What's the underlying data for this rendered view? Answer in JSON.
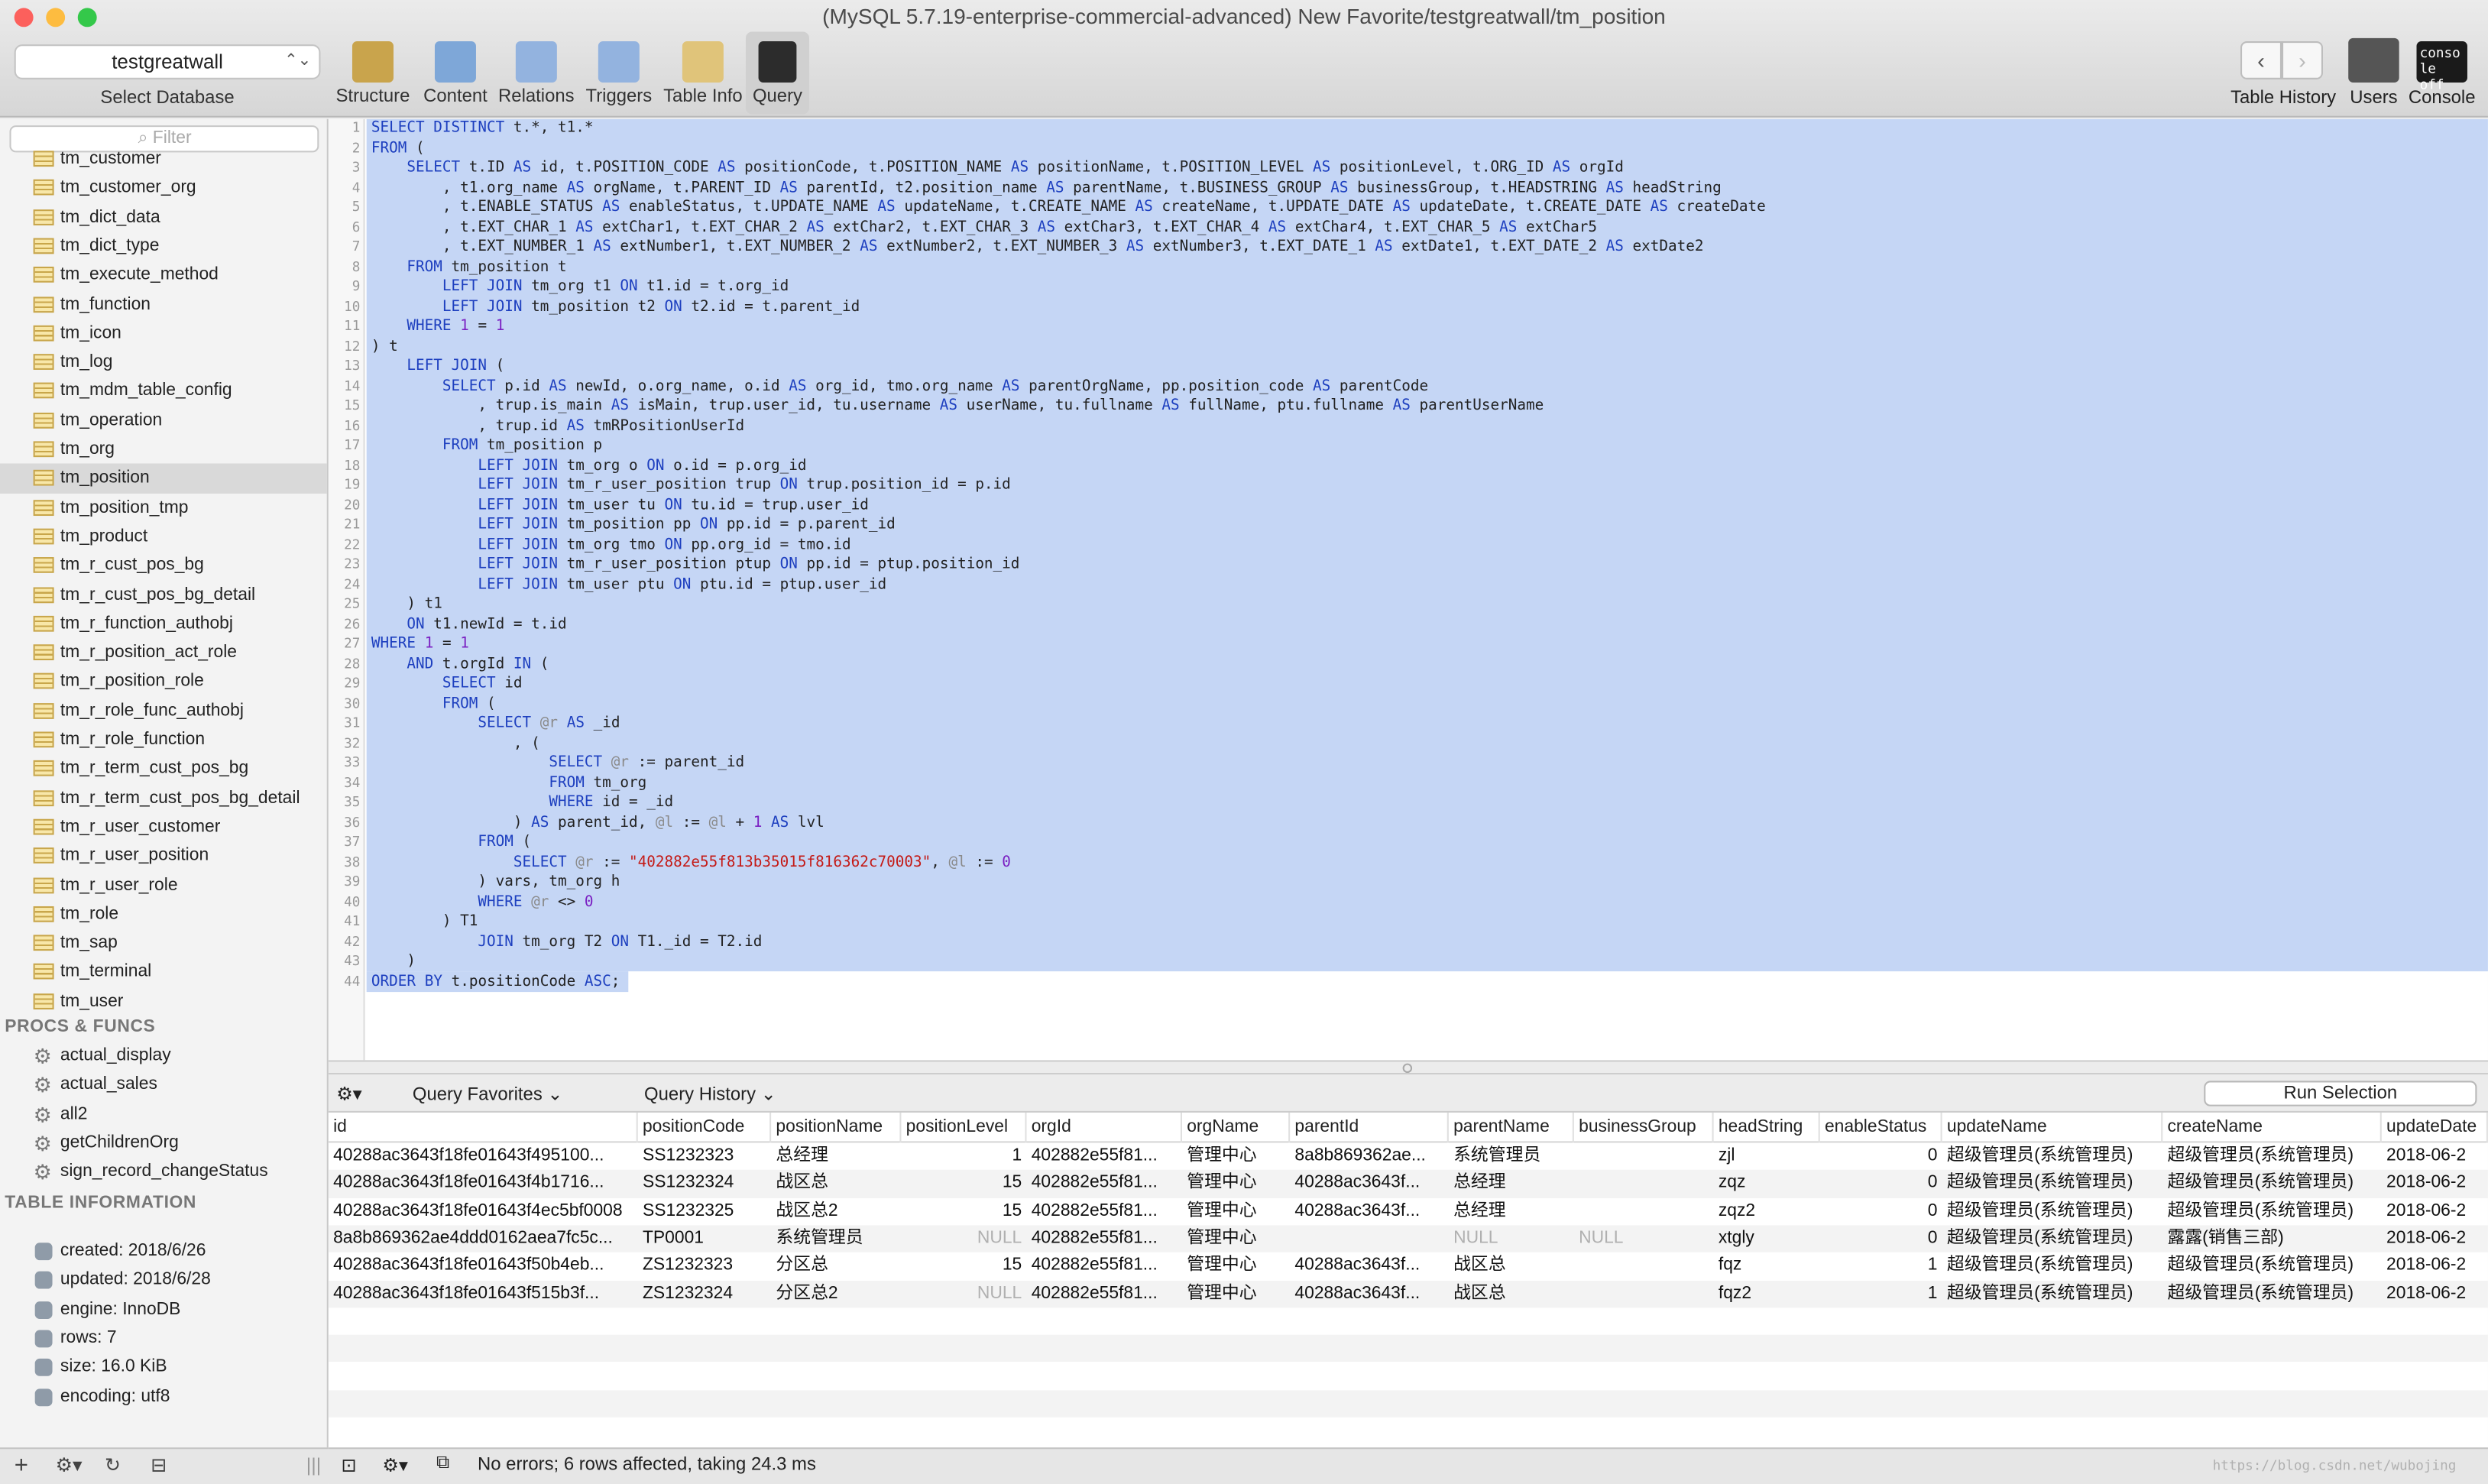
{
  "window": {
    "title": "(MySQL 5.7.19-enterprise-commercial-advanced) New Favorite/testgreatwall/tm_position"
  },
  "database": {
    "selected": "testgreatwall",
    "label": "Select Database"
  },
  "toolbar": [
    "Structure",
    "Content",
    "Relations",
    "Triggers",
    "Table Info",
    "Query"
  ],
  "toolbar_right": [
    "Table History",
    "Users",
    "Console"
  ],
  "sidebar": {
    "filter_placeholder": "Filter",
    "tables": [
      "tm_customer",
      "tm_customer_org",
      "tm_dict_data",
      "tm_dict_type",
      "tm_execute_method",
      "tm_function",
      "tm_icon",
      "tm_log",
      "tm_mdm_table_config",
      "tm_operation",
      "tm_org",
      "tm_position",
      "tm_position_tmp",
      "tm_product",
      "tm_r_cust_pos_bg",
      "tm_r_cust_pos_bg_detail",
      "tm_r_function_authobj",
      "tm_r_position_act_role",
      "tm_r_position_role",
      "tm_r_role_func_authobj",
      "tm_r_role_function",
      "tm_r_term_cust_pos_bg",
      "tm_r_term_cust_pos_bg_detail",
      "tm_r_user_customer",
      "tm_r_user_position",
      "tm_r_user_role",
      "tm_role",
      "tm_sap",
      "tm_terminal",
      "tm_user"
    ],
    "selected_table": "tm_position",
    "procs_header": "PROCS & FUNCS",
    "procs": [
      "actual_display",
      "actual_sales",
      "all2",
      "getChildrenOrg",
      "sign_record_changeStatus"
    ],
    "info_header": "TABLE INFORMATION",
    "info": [
      "created: 2018/6/26",
      "updated: 2018/6/28",
      "engine: InnoDB",
      "rows: 7",
      "size: 16.0 KiB",
      "encoding: utf8"
    ]
  },
  "query_lines": [
    "SELECT DISTINCT t.*, t1.*",
    "FROM (",
    "    SELECT t.ID AS id, t.POSITION_CODE AS positionCode, t.POSITION_NAME AS positionName, t.POSITION_LEVEL AS positionLevel, t.ORG_ID AS orgId",
    "        , t1.org_name AS orgName, t.PARENT_ID AS parentId, t2.position_name AS parentName, t.BUSINESS_GROUP AS businessGroup, t.HEADSTRING AS headString",
    "        , t.ENABLE_STATUS AS enableStatus, t.UPDATE_NAME AS updateName, t.CREATE_NAME AS createName, t.UPDATE_DATE AS updateDate, t.CREATE_DATE AS createDate",
    "        , t.EXT_CHAR_1 AS extChar1, t.EXT_CHAR_2 AS extChar2, t.EXT_CHAR_3 AS extChar3, t.EXT_CHAR_4 AS extChar4, t.EXT_CHAR_5 AS extChar5",
    "        , t.EXT_NUMBER_1 AS extNumber1, t.EXT_NUMBER_2 AS extNumber2, t.EXT_NUMBER_3 AS extNumber3, t.EXT_DATE_1 AS extDate1, t.EXT_DATE_2 AS extDate2",
    "    FROM tm_position t",
    "        LEFT JOIN tm_org t1 ON t1.id = t.org_id",
    "        LEFT JOIN tm_position t2 ON t2.id = t.parent_id",
    "    WHERE 1 = 1",
    ") t",
    "    LEFT JOIN (",
    "        SELECT p.id AS newId, o.org_name, o.id AS org_id, tmo.org_name AS parentOrgName, pp.position_code AS parentCode",
    "            , trup.is_main AS isMain, trup.user_id, tu.username AS userName, tu.fullname AS fullName, ptu.fullname AS parentUserName",
    "            , trup.id AS tmRPositionUserId",
    "        FROM tm_position p",
    "            LEFT JOIN tm_org o ON o.id = p.org_id",
    "            LEFT JOIN tm_r_user_position trup ON trup.position_id = p.id",
    "            LEFT JOIN tm_user tu ON tu.id = trup.user_id",
    "            LEFT JOIN tm_position pp ON pp.id = p.parent_id",
    "            LEFT JOIN tm_org tmo ON pp.org_id = tmo.id",
    "            LEFT JOIN tm_r_user_position ptup ON pp.id = ptup.position_id",
    "            LEFT JOIN tm_user ptu ON ptu.id = ptup.user_id",
    "    ) t1",
    "    ON t1.newId = t.id",
    "WHERE 1 = 1",
    "    AND t.orgId IN (",
    "        SELECT id",
    "        FROM (",
    "            SELECT @r AS _id",
    "                , (",
    "                    SELECT @r := parent_id",
    "                    FROM tm_org",
    "                    WHERE id = _id",
    "                ) AS parent_id, @l := @l + 1 AS lvl",
    "            FROM (",
    "                SELECT @r := \"402882e55f813b35015f816362c70003\", @l := 0",
    "            ) vars, tm_org h",
    "            WHERE @r <> 0",
    "        ) T1",
    "            JOIN tm_org T2 ON T1._id = T2.id",
    "    )",
    "ORDER BY t.positionCode ASC;"
  ],
  "results_bar": {
    "favorites": "Query Favorites",
    "history": "Query History",
    "run": "Run Selection"
  },
  "columns": [
    "id",
    "positionCode",
    "positionName",
    "positionLevel",
    "orgId",
    "orgName",
    "parentId",
    "parentName",
    "businessGroup",
    "headString",
    "enableStatus",
    "updateName",
    "createName",
    "updateDate"
  ],
  "rows": [
    [
      "40288ac3643f18fe01643f495100...",
      "SS1232323",
      "总经理",
      "1",
      "402882e55f81...",
      "管理中心",
      "8a8b869362ae...",
      "系统管理员",
      "",
      "zjl",
      "0",
      "超级管理员(系统管理员)",
      "超级管理员(系统管理员)",
      "2018-06-2"
    ],
    [
      "40288ac3643f18fe01643f4b1716...",
      "SS1232324",
      "战区总",
      "15",
      "402882e55f81...",
      "管理中心",
      "40288ac3643f...",
      "总经理",
      "",
      "zqz",
      "0",
      "超级管理员(系统管理员)",
      "超级管理员(系统管理员)",
      "2018-06-2"
    ],
    [
      "40288ac3643f18fe01643f4ec5bf0008",
      "SS1232325",
      "战区总2",
      "15",
      "402882e55f81...",
      "管理中心",
      "40288ac3643f...",
      "总经理",
      "",
      "zqz2",
      "0",
      "超级管理员(系统管理员)",
      "超级管理员(系统管理员)",
      "2018-06-2"
    ],
    [
      "8a8b869362ae4ddd0162aea7fc5c...",
      "TP0001",
      "系统管理员",
      "NULL",
      "402882e55f81...",
      "管理中心",
      "",
      "NULL",
      "NULL",
      "xtgly",
      "0",
      "超级管理员(系统管理员)",
      "露露(销售三部)",
      "2018-06-2"
    ],
    [
      "40288ac3643f18fe01643f50b4eb...",
      "ZS1232323",
      "分区总",
      "15",
      "402882e55f81...",
      "管理中心",
      "40288ac3643f...",
      "战区总",
      "",
      "fqz",
      "1",
      "超级管理员(系统管理员)",
      "超级管理员(系统管理员)",
      "2018-06-2"
    ],
    [
      "40288ac3643f18fe01643f515b3f...",
      "ZS1232324",
      "分区总2",
      "NULL",
      "402882e55f81...",
      "管理中心",
      "40288ac3643f...",
      "战区总",
      "",
      "fqz2",
      "1",
      "超级管理员(系统管理员)",
      "超级管理员(系统管理员)",
      "2018-06-2"
    ]
  ],
  "status": "No errors; 6 rows affected, taking 24.3 ms",
  "watermark": "https://blog.csdn.net/wubojing"
}
